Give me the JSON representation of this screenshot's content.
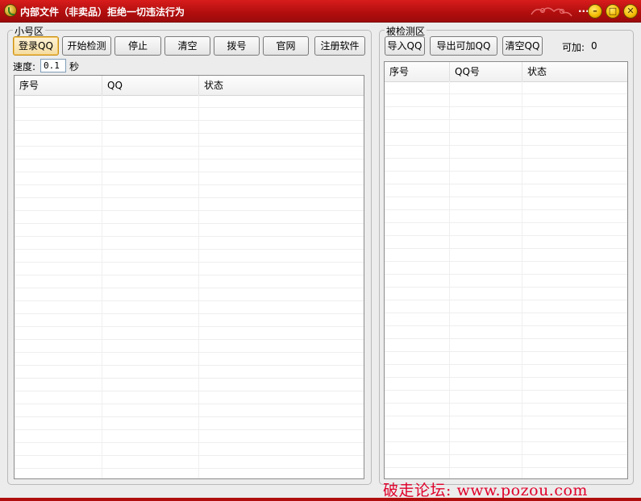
{
  "window": {
    "title": "内部文件（非卖品）拒绝一切违法行为",
    "extra_btn": "...",
    "min_btn": "–",
    "max_btn": "□",
    "close_btn": "✕"
  },
  "left_panel": {
    "title": "小号区",
    "buttons": {
      "login": "登录QQ",
      "start": "开始检测",
      "stop": "停止",
      "clear": "清空",
      "dial": "拨号",
      "website": "官网",
      "register": "注册软件"
    },
    "speed_label": "速度:",
    "speed_value": "0.1",
    "speed_unit": "秒",
    "columns": [
      "序号",
      "QQ",
      "状态"
    ]
  },
  "right_panel": {
    "title": "被检测区",
    "buttons": {
      "import": "导入QQ",
      "export": "导出可加QQ",
      "clear": "清空QQ"
    },
    "addable_label": "可加:",
    "addable_count": "0",
    "columns": [
      "序号",
      "QQ号",
      "状态"
    ]
  },
  "watermark": "破走论坛: www.pozou.com"
}
